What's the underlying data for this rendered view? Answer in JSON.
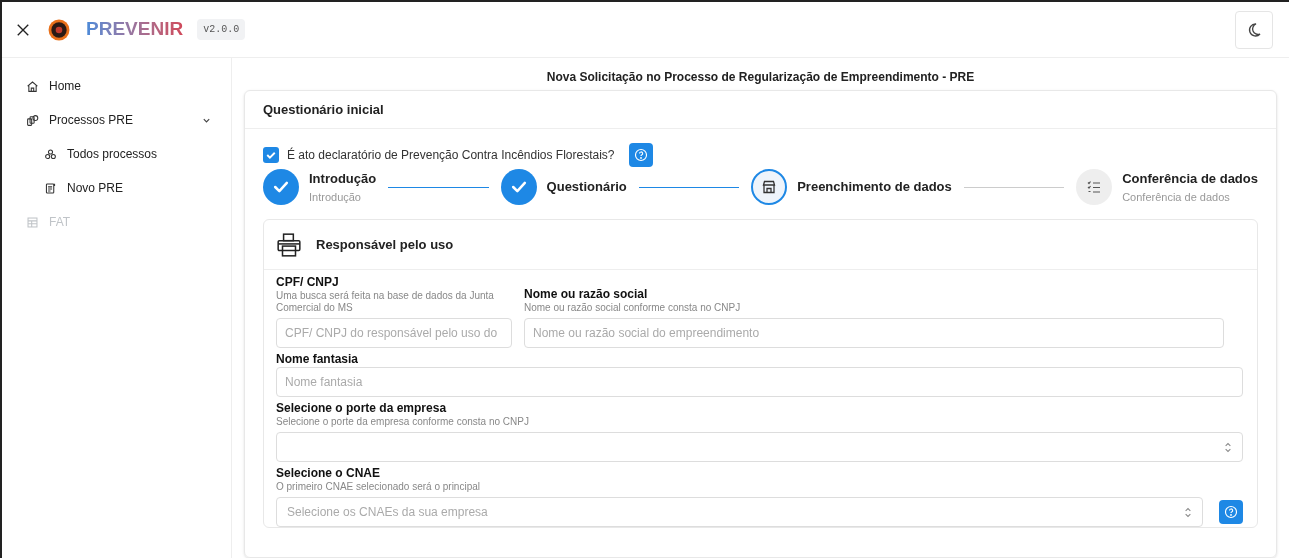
{
  "header": {
    "app_name": "PREVENIR",
    "version": "v2.0.0"
  },
  "sidebar": {
    "items": [
      {
        "label": "Home",
        "disabled": false
      },
      {
        "label": "Processos PRE",
        "disabled": false,
        "expanded": true,
        "children": [
          {
            "label": "Todos processos"
          },
          {
            "label": "Novo PRE"
          }
        ]
      },
      {
        "label": "FAT",
        "disabled": true
      }
    ]
  },
  "page_title": "Nova Solicitação no Processo de Regularização de Empreendimento - PRE",
  "card": {
    "title": "Questionário inicial",
    "declaration": {
      "label": "É ato declaratório de Prevenção Contra Incêndios Florestais?",
      "checked": true
    },
    "steps": [
      {
        "title": "Introdução",
        "subtitle": "Introdução",
        "kind": "done"
      },
      {
        "title": "Questionário",
        "kind": "done"
      },
      {
        "title": "Preenchimento de dados",
        "kind": "active"
      },
      {
        "title": "Conferência de dados",
        "subtitle": "Conferência de dados",
        "kind": "pending"
      }
    ],
    "section": {
      "title": "Responsável pelo uso",
      "rows": [
        [
          {
            "kind": "input",
            "label": "CPF/ CNPJ",
            "hint": "Uma busca será feita na base de dados da Junta Comercial do MS",
            "placeholder": "CPF/ CNPJ do responsável pelo uso do"
          },
          {
            "kind": "input",
            "label": "Nome ou razão social",
            "hint": "Nome ou razão social conforme consta no CNPJ",
            "placeholder": "Nome ou razão social do empreendimento"
          }
        ],
        [
          {
            "kind": "input",
            "label": "Nome fantasia",
            "placeholder": "Nome fantasia"
          }
        ],
        [
          {
            "kind": "select",
            "label": "Selecione o porte da empresa",
            "hint": "Selecione o porte da empresa conforme consta no CNPJ"
          }
        ],
        [
          {
            "kind": "select",
            "label": "Selecione o CNAE",
            "hint": "O primeiro CNAE selecionado será o principal",
            "placeholder": "Selecione os CNAEs da sua empresa",
            "help": true
          }
        ]
      ]
    }
  }
}
